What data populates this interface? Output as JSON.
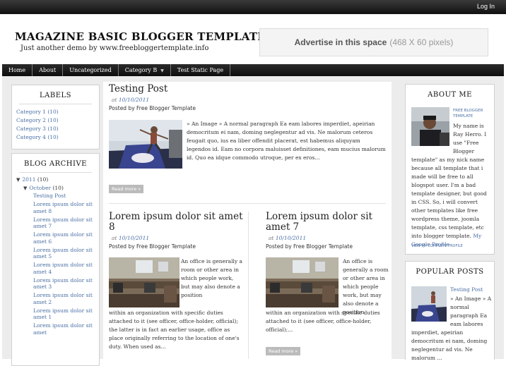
{
  "topbar": {
    "login": "Log In"
  },
  "header": {
    "title": "MAGAZINE BASIC BLOGGER TEMPLATE",
    "tagline": "Just another demo by www.freebloggertemplate.info",
    "ad_main": "Advertise in this space",
    "ad_size": "(468 X 60 pixels)"
  },
  "nav": [
    {
      "label": "Home"
    },
    {
      "label": "About"
    },
    {
      "label": "Uncategorized"
    },
    {
      "label": "Category B"
    },
    {
      "label": "Test Static Page"
    }
  ],
  "labels": {
    "title": "LABELS",
    "items": [
      "Category 1 (10)",
      "Category 2 (10)",
      "Category 3 (10)",
      "Category 4 (10)"
    ]
  },
  "archive": {
    "title": "BLOG ARCHIVE",
    "year": "2011",
    "year_count": "(10)",
    "month": "October",
    "month_count": "(10)",
    "posts": [
      "Testing Post",
      "Lorem ipsum dolor sit amet 8",
      "Lorem ipsum dolor sit amet 7",
      "Lorem ipsum dolor sit amet 6",
      "Lorem ipsum dolor sit amet 5",
      "Lorem ipsum dolor sit amet 4",
      "Lorem ipsum dolor sit amet 3",
      "Lorem ipsum dolor sit amet 2",
      "Lorem ipsum dolor sit amet 1",
      "Lorem ipsum dolor sit amet"
    ]
  },
  "post1": {
    "title": "Testing Post",
    "at": "at",
    "date": "10/10/2011",
    "by": "Posted by Free Blogger Template",
    "excerpt": "» An Image » A normal paragraph Ea eam labores imperdiet, apeirian democritum ei nam, doming neglegentur ad vis. Ne malorum ceteros feugait quo, ius ea liber offendit placerat, est habemus aliquyam legendos id. Eam no corpora maluisset definitiones, eam mucius malorum id. Quo ea idque commodo utroque, per ex eros...",
    "readmore": "Read more »"
  },
  "post2": {
    "title": "Lorem ipsum dolor sit amet 8",
    "at": "at",
    "date": "10/10/2011",
    "by": "Posted by Free Blogger Template",
    "excerpt_side": "An office is generally a room or other area in which people work, but may also denote a position",
    "excerpt_full": "within an organization with specific duties attached to it (see officer, office-holder, official); the latter is in fact an earlier usage, office as place originally referring to the location of one's duty. When used as..."
  },
  "post3": {
    "title": "Lorem ipsum dolor sit amet 7",
    "at": "at",
    "date": "10/10/2011",
    "by": "Posted by Free Blogger Template",
    "excerpt_side": "An office is generally a room or other area in which people work, but may also denote a position",
    "excerpt_full": "within an organization with specific duties attached to it (see officer, office-holder, official);...",
    "readmore": "Read more »"
  },
  "about": {
    "title": "ABOUT ME",
    "name_link": "FREE BLOGGER TEMPLATE",
    "text_side": "My name is Ray Herro. I use \"Free Blogger",
    "text_full": "template\" as my nick name because all template that i made will be free to all blogspot user. I'm a bad template designer, but good in CSS. So, i will convert other templates like free wordpress theme, joomla template, css template, etc into blogger template.",
    "profile_link": "My Google Profile",
    "view_profile": "VIEW MY COMPLETE PROFILE"
  },
  "popular": {
    "title": "POPULAR POSTS",
    "post_link": "Testing Post",
    "text_side": "» An Image » A normal paragraph Ea eam labores",
    "text_full": "imperdiet, apeirian democritum ei nam, doming neglegentur ad vis. Ne malorum ..."
  },
  "colors": {
    "link": "#4a6fa5",
    "nav_bg": "#111111",
    "page_bg": "#ececec"
  }
}
